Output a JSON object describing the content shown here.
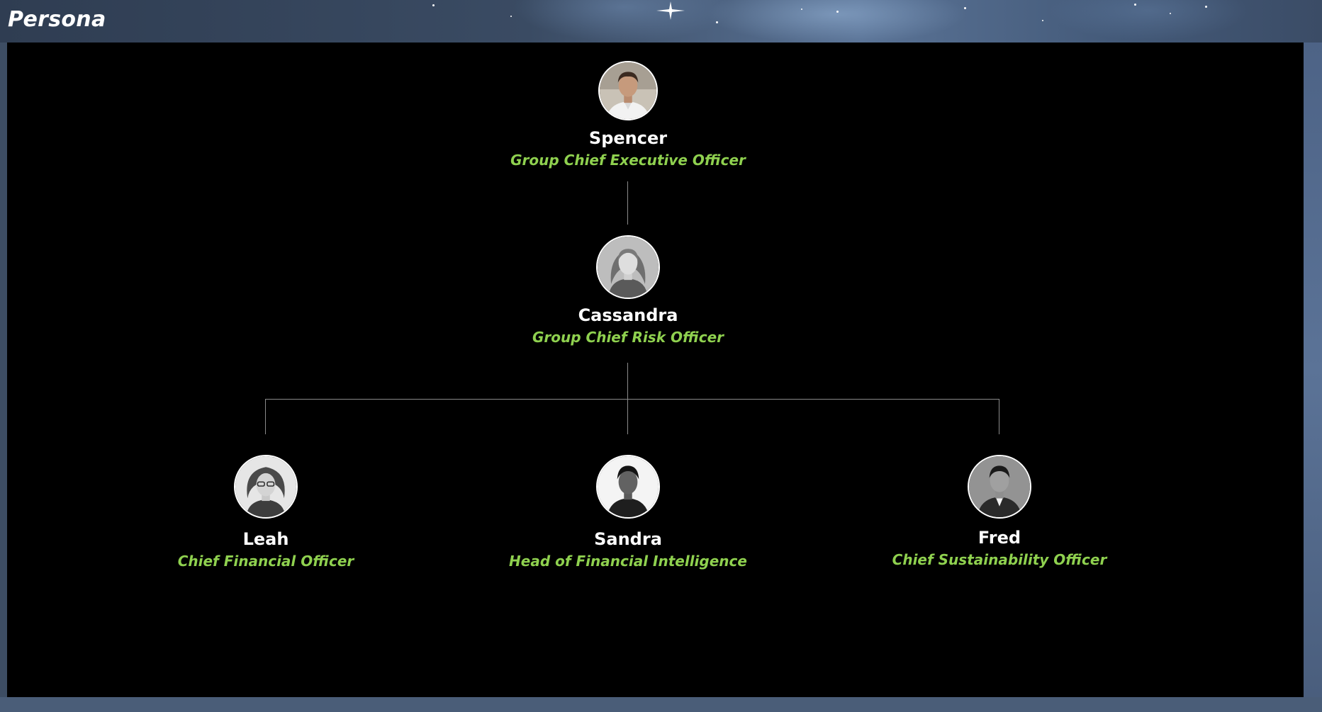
{
  "header": {
    "title": "Persona"
  },
  "org_chart": {
    "root": {
      "name": "Spencer",
      "title": "Group Chief Executive Officer",
      "avatar_icon": "person-photo-icon"
    },
    "manager": {
      "name": "Cassandra",
      "title": "Group Chief Risk Officer",
      "avatar_icon": "person-photo-icon"
    },
    "reports": [
      {
        "name": "Leah",
        "title": "Chief Financial Officer",
        "avatar_icon": "person-photo-icon"
      },
      {
        "name": "Sandra",
        "title": "Head of Financial Intelligence",
        "avatar_icon": "person-photo-icon"
      },
      {
        "name": "Fred",
        "title": "Chief Sustainability Officer",
        "avatar_icon": "person-photo-icon"
      }
    ]
  },
  "colors": {
    "canvas_background": "#000000",
    "name_text": "#ffffff",
    "role_text": "#8fd14f",
    "connector_line": "#8a8a8a",
    "page_frame": "#3d4d63"
  }
}
